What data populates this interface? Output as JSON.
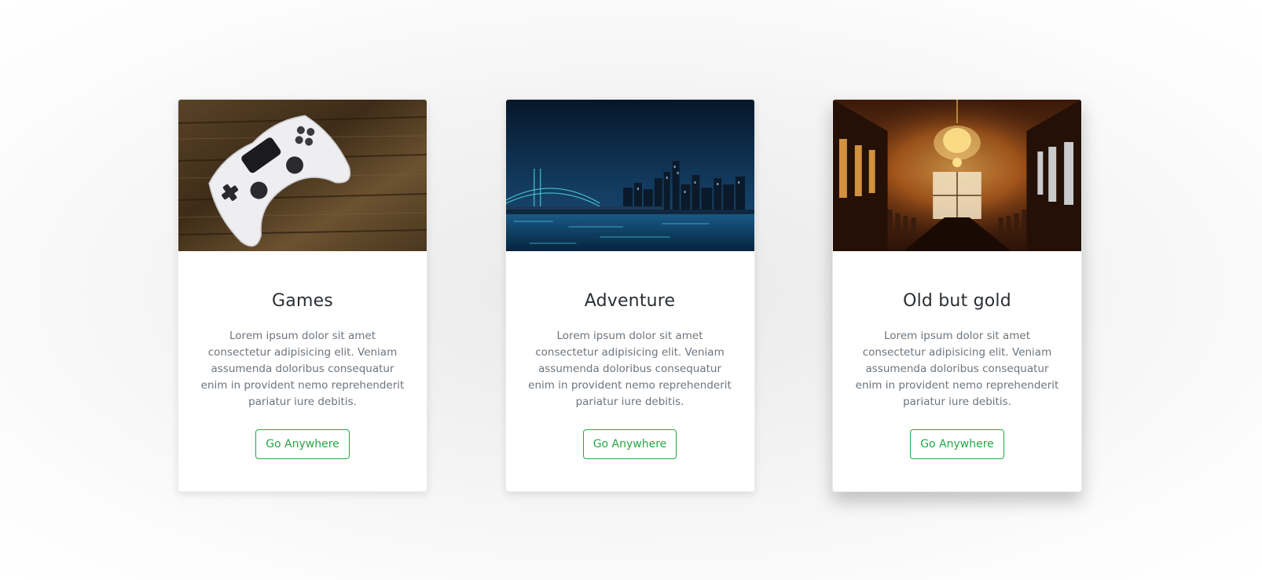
{
  "cards": [
    {
      "title": "Games",
      "text": "Lorem ipsum dolor sit amet consectetur adipisicing elit. Veniam assumenda doloribus consequatur enim in provident nemo reprehenderit pariatur iure debitis.",
      "button_label": "Go Anywhere",
      "image_icon": "game-controller-photo"
    },
    {
      "title": "Adventure",
      "text": "Lorem ipsum dolor sit amet consectetur adipisicing elit. Veniam assumenda doloribus consequatur enim in provident nemo reprehenderit pariatur iure debitis.",
      "button_label": "Go Anywhere",
      "image_icon": "city-night-bridge-photo"
    },
    {
      "title": "Old but gold",
      "text": "Lorem ipsum dolor sit amet consectetur adipisicing elit. Veniam assumenda doloribus consequatur enim in provident nemo reprehenderit pariatur iure debitis.",
      "button_label": "Go Anywhere",
      "image_icon": "chandelier-hall-photo"
    }
  ],
  "colors": {
    "button_accent": "#28a745",
    "title_text": "#2b2f33",
    "body_text": "#6c757d"
  }
}
